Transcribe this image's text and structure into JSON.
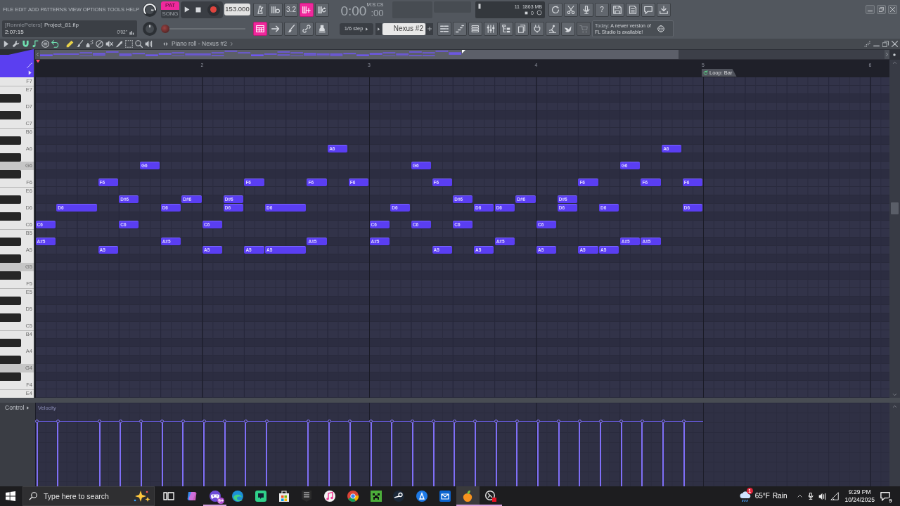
{
  "menu": [
    "FILE",
    "EDIT",
    "ADD",
    "PATTERNS",
    "VIEW",
    "OPTIONS",
    "TOOLS",
    "HELP"
  ],
  "knobs": [
    {
      "kind": "volume"
    },
    {
      "kind": "pitch"
    }
  ],
  "mode": [
    {
      "label": "PAT",
      "selected": true
    },
    {
      "label": "SONG",
      "selected": false
    }
  ],
  "tempo": "153.000",
  "record_buttons": [
    {
      "kind": "metronome",
      "on": false
    },
    {
      "kind": "wait",
      "on": false
    },
    {
      "kind": "countdown",
      "label": "3.2",
      "on": false
    },
    {
      "kind": "step-edit",
      "on": true
    },
    {
      "kind": "loop-record",
      "on": false
    }
  ],
  "time": {
    "value": "0:00",
    "fraction": ":00",
    "format": "M:S:CS"
  },
  "monitor": {
    "reading": "11",
    "memory": "1863 MB",
    "count": "0"
  },
  "tool_buttons": [
    {
      "kind": "refresh"
    },
    {
      "kind": "cut"
    },
    {
      "kind": "mic"
    },
    {
      "kind": "help",
      "label": "?"
    },
    {
      "kind": "save"
    },
    {
      "kind": "save-as"
    },
    {
      "kind": "chat"
    },
    {
      "kind": "download"
    }
  ],
  "project": {
    "user": "[RonniePeters]",
    "file": "Project_81.flp",
    "time": "2:07:15",
    "length": "0'02\""
  },
  "song_position": {
    "level": 0
  },
  "mode_buttons": [
    {
      "kind": "pattern-song",
      "on": true
    },
    {
      "kind": "arrow",
      "on": false
    },
    {
      "kind": "brush",
      "on": false
    },
    {
      "kind": "link",
      "on": false
    },
    {
      "kind": "stamp",
      "on": false
    }
  ],
  "snap": "1/6 step",
  "pattern": "Nexus #2",
  "window_buttons": [
    {
      "kind": "playlist",
      "disabled": false
    },
    {
      "kind": "piano-roll",
      "disabled": false
    },
    {
      "kind": "channel-rack",
      "disabled": false
    },
    {
      "kind": "mixer",
      "disabled": false
    },
    {
      "kind": "browser",
      "disabled": false
    },
    {
      "kind": "clipboard",
      "disabled": false
    },
    {
      "kind": "plugin",
      "disabled": false
    },
    {
      "kind": "lamp",
      "disabled": false
    },
    {
      "kind": "bird",
      "disabled": false
    },
    {
      "kind": "cart",
      "disabled": true
    }
  ],
  "hint": {
    "label": "Today:",
    "text": "A newer version of FL Studio is available!"
  },
  "piano_roll": {
    "title": "Piano roll - Nexus #2",
    "options": [
      {
        "kind": "menu",
        "on": false
      },
      {
        "kind": "wrench",
        "on": false
      },
      {
        "kind": "magnet",
        "on": true
      },
      {
        "kind": "note",
        "on": true
      },
      {
        "kind": "target",
        "on": false
      },
      {
        "kind": "undo",
        "on": true
      }
    ],
    "tools": [
      {
        "kind": "pencil",
        "selected": true
      },
      {
        "kind": "brush",
        "selected": false
      },
      {
        "kind": "spray",
        "selected": false
      },
      {
        "kind": "delete",
        "selected": false
      },
      {
        "kind": "mute",
        "selected": false
      },
      {
        "kind": "slice",
        "selected": false
      },
      {
        "kind": "select",
        "selected": false
      },
      {
        "kind": "zoom",
        "selected": false
      },
      {
        "kind": "speaker",
        "selected": false
      }
    ],
    "ruler": [
      {
        "label": "2"
      },
      {
        "label": "3"
      },
      {
        "label": "4"
      },
      {
        "label": "5",
        "loop": "Loop: Bar"
      },
      {
        "label": "6"
      }
    ],
    "keys": [
      {
        "kind": "white",
        "label": "F7",
        "highlighted": false
      },
      {
        "kind": "white",
        "label": "E7",
        "highlighted": false
      },
      {
        "kind": "black",
        "highlighted": false
      },
      {
        "kind": "white",
        "label": "D7",
        "highlighted": false
      },
      {
        "kind": "black",
        "highlighted": false
      },
      {
        "kind": "white",
        "label": "C7",
        "highlighted": false
      },
      {
        "kind": "white",
        "label": "B6",
        "highlighted": false
      },
      {
        "kind": "black",
        "highlighted": false
      },
      {
        "kind": "white",
        "label": "A6",
        "highlighted": false,
        "slots": [
          {
            "kind": "rest"
          },
          {
            "kind": "rest"
          },
          {
            "kind": "rest"
          },
          {
            "kind": "rest"
          },
          {
            "kind": "rest"
          },
          {
            "kind": "rest"
          },
          {
            "kind": "rest"
          },
          {
            "kind": "rest"
          },
          {
            "kind": "rest"
          },
          {
            "kind": "rest"
          },
          {
            "kind": "rest"
          },
          {
            "kind": "rest"
          },
          {
            "kind": "rest"
          },
          {
            "kind": "rest"
          },
          {
            "kind": "eighth",
            "label": "A6"
          },
          {
            "kind": "rest"
          },
          {
            "kind": "rest"
          },
          {
            "kind": "rest"
          },
          {
            "kind": "rest"
          },
          {
            "kind": "rest"
          },
          {
            "kind": "rest"
          },
          {
            "kind": "rest"
          },
          {
            "kind": "rest"
          },
          {
            "kind": "rest"
          },
          {
            "kind": "rest"
          },
          {
            "kind": "rest"
          },
          {
            "kind": "rest"
          },
          {
            "kind": "rest"
          },
          {
            "kind": "rest"
          },
          {
            "kind": "rest"
          },
          {
            "kind": "eighth",
            "label": "A6"
          }
        ]
      },
      {
        "kind": "black",
        "highlighted": false
      },
      {
        "kind": "white",
        "label": "G6",
        "highlighted": true,
        "slots": [
          {
            "kind": "rest"
          },
          {
            "kind": "rest"
          },
          {
            "kind": "rest"
          },
          {
            "kind": "rest"
          },
          {
            "kind": "rest"
          },
          {
            "kind": "eighth",
            "label": "G6"
          },
          {
            "kind": "rest"
          },
          {
            "kind": "rest"
          },
          {
            "kind": "rest"
          },
          {
            "kind": "rest"
          },
          {
            "kind": "rest"
          },
          {
            "kind": "rest"
          },
          {
            "kind": "rest"
          },
          {
            "kind": "rest"
          },
          {
            "kind": "rest"
          },
          {
            "kind": "rest"
          },
          {
            "kind": "rest"
          },
          {
            "kind": "rest"
          },
          {
            "kind": "eighth",
            "label": "G6"
          },
          {
            "kind": "rest"
          },
          {
            "kind": "rest"
          },
          {
            "kind": "rest"
          },
          {
            "kind": "rest"
          },
          {
            "kind": "rest"
          },
          {
            "kind": "rest"
          },
          {
            "kind": "rest"
          },
          {
            "kind": "rest"
          },
          {
            "kind": "rest"
          },
          {
            "kind": "eighth",
            "label": "G6"
          }
        ]
      },
      {
        "kind": "black",
        "highlighted": false
      },
      {
        "kind": "white",
        "label": "F6",
        "highlighted": false,
        "slots": [
          {
            "kind": "rest"
          },
          {
            "kind": "rest"
          },
          {
            "kind": "rest"
          },
          {
            "kind": "eighth",
            "label": "F6"
          },
          {
            "kind": "rest"
          },
          {
            "kind": "rest"
          },
          {
            "kind": "rest"
          },
          {
            "kind": "rest"
          },
          {
            "kind": "rest"
          },
          {
            "kind": "rest"
          },
          {
            "kind": "eighth",
            "label": "F6"
          },
          {
            "kind": "rest"
          },
          {
            "kind": "rest"
          },
          {
            "kind": "eighth",
            "label": "F6"
          },
          {
            "kind": "rest"
          },
          {
            "kind": "eighth",
            "label": "F6"
          },
          {
            "kind": "rest"
          },
          {
            "kind": "rest"
          },
          {
            "kind": "rest"
          },
          {
            "kind": "eighth",
            "label": "F6"
          },
          {
            "kind": "rest"
          },
          {
            "kind": "rest"
          },
          {
            "kind": "rest"
          },
          {
            "kind": "rest"
          },
          {
            "kind": "rest"
          },
          {
            "kind": "rest"
          },
          {
            "kind": "eighth",
            "label": "F6"
          },
          {
            "kind": "rest"
          },
          {
            "kind": "rest"
          },
          {
            "kind": "eighth",
            "label": "F6"
          },
          {
            "kind": "rest"
          },
          {
            "kind": "eighth",
            "label": "F6"
          }
        ]
      },
      {
        "kind": "white",
        "label": "E6",
        "highlighted": false
      },
      {
        "kind": "black",
        "highlighted": false,
        "slots": [
          {
            "kind": "rest"
          },
          {
            "kind": "rest"
          },
          {
            "kind": "rest"
          },
          {
            "kind": "rest"
          },
          {
            "kind": "eighth",
            "label": "D#6"
          },
          {
            "kind": "rest"
          },
          {
            "kind": "rest"
          },
          {
            "kind": "eighth",
            "label": "D#6"
          },
          {
            "kind": "rest"
          },
          {
            "kind": "eighth",
            "label": "D#6"
          },
          {
            "kind": "rest"
          },
          {
            "kind": "rest"
          },
          {
            "kind": "rest"
          },
          {
            "kind": "rest"
          },
          {
            "kind": "rest"
          },
          {
            "kind": "rest"
          },
          {
            "kind": "rest"
          },
          {
            "kind": "rest"
          },
          {
            "kind": "rest"
          },
          {
            "kind": "rest"
          },
          {
            "kind": "eighth",
            "label": "D#6"
          },
          {
            "kind": "rest"
          },
          {
            "kind": "rest"
          },
          {
            "kind": "eighth",
            "label": "D#6"
          },
          {
            "kind": "rest"
          },
          {
            "kind": "eighth",
            "label": "D#6"
          }
        ]
      },
      {
        "kind": "white",
        "label": "D6",
        "highlighted": false,
        "slots": [
          {
            "kind": "rest"
          },
          {
            "kind": "quarter",
            "label": "D6"
          },
          {
            "kind": "rest"
          },
          {
            "kind": "rest"
          },
          {
            "kind": "rest"
          },
          {
            "kind": "eighth",
            "label": "D6"
          },
          {
            "kind": "rest"
          },
          {
            "kind": "rest"
          },
          {
            "kind": "eighth",
            "label": "D6"
          },
          {
            "kind": "rest"
          },
          {
            "kind": "quarter",
            "label": "D6"
          },
          {
            "kind": "rest"
          },
          {
            "kind": "rest"
          },
          {
            "kind": "rest"
          },
          {
            "kind": "rest"
          },
          {
            "kind": "eighth",
            "label": "D6"
          },
          {
            "kind": "rest"
          },
          {
            "kind": "rest"
          },
          {
            "kind": "rest"
          },
          {
            "kind": "eighth",
            "label": "D6"
          },
          {
            "kind": "eighth",
            "label": "D6"
          },
          {
            "kind": "rest"
          },
          {
            "kind": "rest"
          },
          {
            "kind": "eighth",
            "label": "D6"
          },
          {
            "kind": "rest"
          },
          {
            "kind": "eighth",
            "label": "D6"
          },
          {
            "kind": "rest"
          },
          {
            "kind": "rest"
          },
          {
            "kind": "rest"
          },
          {
            "kind": "eighth",
            "label": "D6"
          }
        ]
      },
      {
        "kind": "black",
        "highlighted": false
      },
      {
        "kind": "white",
        "label": "C6",
        "highlighted": false,
        "slots": [
          {
            "kind": "eighth",
            "label": "C6"
          },
          {
            "kind": "rest"
          },
          {
            "kind": "rest"
          },
          {
            "kind": "rest"
          },
          {
            "kind": "eighth",
            "label": "C6"
          },
          {
            "kind": "rest"
          },
          {
            "kind": "rest"
          },
          {
            "kind": "rest"
          },
          {
            "kind": "eighth",
            "label": "C6"
          },
          {
            "kind": "rest"
          },
          {
            "kind": "rest"
          },
          {
            "kind": "rest"
          },
          {
            "kind": "rest"
          },
          {
            "kind": "rest"
          },
          {
            "kind": "rest"
          },
          {
            "kind": "rest"
          },
          {
            "kind": "eighth",
            "label": "C6"
          },
          {
            "kind": "rest"
          },
          {
            "kind": "eighth",
            "label": "C6"
          },
          {
            "kind": "rest"
          },
          {
            "kind": "eighth",
            "label": "C6"
          },
          {
            "kind": "rest"
          },
          {
            "kind": "rest"
          },
          {
            "kind": "rest"
          },
          {
            "kind": "eighth",
            "label": "C6"
          }
        ]
      },
      {
        "kind": "white",
        "label": "B5",
        "highlighted": false
      },
      {
        "kind": "black",
        "highlighted": false,
        "slots": [
          {
            "kind": "eighth",
            "label": "A#5"
          },
          {
            "kind": "rest"
          },
          {
            "kind": "rest"
          },
          {
            "kind": "rest"
          },
          {
            "kind": "rest"
          },
          {
            "kind": "rest"
          },
          {
            "kind": "eighth",
            "label": "A#5"
          },
          {
            "kind": "rest"
          },
          {
            "kind": "rest"
          },
          {
            "kind": "rest"
          },
          {
            "kind": "rest"
          },
          {
            "kind": "rest"
          },
          {
            "kind": "rest"
          },
          {
            "kind": "eighth",
            "label": "A#5"
          },
          {
            "kind": "rest"
          },
          {
            "kind": "rest"
          },
          {
            "kind": "eighth",
            "label": "A#5"
          },
          {
            "kind": "rest"
          },
          {
            "kind": "rest"
          },
          {
            "kind": "rest"
          },
          {
            "kind": "rest"
          },
          {
            "kind": "rest"
          },
          {
            "kind": "eighth",
            "label": "A#5"
          },
          {
            "kind": "rest"
          },
          {
            "kind": "rest"
          },
          {
            "kind": "rest"
          },
          {
            "kind": "rest"
          },
          {
            "kind": "rest"
          },
          {
            "kind": "eighth",
            "label": "A#5"
          },
          {
            "kind": "eighth",
            "label": "A#5"
          }
        ]
      },
      {
        "kind": "white",
        "label": "A5",
        "highlighted": false,
        "slots": [
          {
            "kind": "rest"
          },
          {
            "kind": "rest"
          },
          {
            "kind": "rest"
          },
          {
            "kind": "eighth",
            "label": "A5"
          },
          {
            "kind": "rest"
          },
          {
            "kind": "rest"
          },
          {
            "kind": "rest"
          },
          {
            "kind": "rest"
          },
          {
            "kind": "eighth",
            "label": "A5"
          },
          {
            "kind": "rest"
          },
          {
            "kind": "eighth",
            "label": "A5"
          },
          {
            "kind": "quarter",
            "label": "A5"
          },
          {
            "kind": "rest"
          },
          {
            "kind": "rest"
          },
          {
            "kind": "rest"
          },
          {
            "kind": "rest"
          },
          {
            "kind": "rest"
          },
          {
            "kind": "rest"
          },
          {
            "kind": "eighth",
            "label": "A5"
          },
          {
            "kind": "rest"
          },
          {
            "kind": "eighth",
            "label": "A5"
          },
          {
            "kind": "rest"
          },
          {
            "kind": "rest"
          },
          {
            "kind": "eighth",
            "label": "A5"
          },
          {
            "kind": "rest"
          },
          {
            "kind": "eighth",
            "label": "A5"
          },
          {
            "kind": "eighth",
            "label": "A5"
          }
        ]
      },
      {
        "kind": "black",
        "highlighted": false
      },
      {
        "kind": "white",
        "label": "G5",
        "highlighted": true
      },
      {
        "kind": "black",
        "highlighted": false
      },
      {
        "kind": "white",
        "label": "F5",
        "highlighted": false
      },
      {
        "kind": "white",
        "label": "E5",
        "highlighted": false
      },
      {
        "kind": "black",
        "highlighted": false
      },
      {
        "kind": "white",
        "label": "D5",
        "highlighted": false
      },
      {
        "kind": "black",
        "highlighted": false
      },
      {
        "kind": "white",
        "label": "C5",
        "highlighted": false
      },
      {
        "kind": "white",
        "label": "B4",
        "highlighted": false
      },
      {
        "kind": "black",
        "highlighted": false
      },
      {
        "kind": "white",
        "label": "A4",
        "highlighted": false
      },
      {
        "kind": "black",
        "highlighted": false
      },
      {
        "kind": "white",
        "label": "G4",
        "highlighted": true
      },
      {
        "kind": "black",
        "highlighted": false
      },
      {
        "kind": "white",
        "label": "F4",
        "highlighted": false
      },
      {
        "kind": "white",
        "label": "E4",
        "highlighted": false
      }
    ],
    "control_lane": {
      "label": "Control",
      "parameter": "Velocity"
    }
  },
  "taskbar": {
    "search": {
      "placeholder": "Type here to search"
    },
    "apps": [
      {
        "kind": "task-view",
        "open": false,
        "active": false
      },
      {
        "kind": "swirl",
        "open": false,
        "active": false
      },
      {
        "kind": "gamepad",
        "badge": "9+",
        "open": true,
        "active": false
      },
      {
        "kind": "wave",
        "open": false,
        "active": false
      },
      {
        "kind": "tile",
        "open": false,
        "active": false
      },
      {
        "kind": "bag",
        "open": false,
        "active": false
      },
      {
        "kind": "shield",
        "open": false,
        "active": false
      },
      {
        "kind": "music",
        "open": false,
        "active": false
      },
      {
        "kind": "wheel",
        "open": false,
        "active": false
      },
      {
        "kind": "pixel-face",
        "open": false,
        "active": false
      },
      {
        "kind": "disc",
        "open": false,
        "active": false
      },
      {
        "kind": "triangle-circle",
        "open": false,
        "active": false
      },
      {
        "kind": "mail",
        "open": false,
        "active": false
      },
      {
        "kind": "fruit",
        "open": true,
        "active": true
      },
      {
        "kind": "ring-record",
        "open": true,
        "active": false
      }
    ],
    "weather": {
      "temperature": "65°F",
      "condition": "Rain",
      "badge": "1"
    },
    "clock": {
      "time": "9:29 PM",
      "date": "10/24/2025"
    },
    "notifications": {
      "badge": "9"
    }
  }
}
